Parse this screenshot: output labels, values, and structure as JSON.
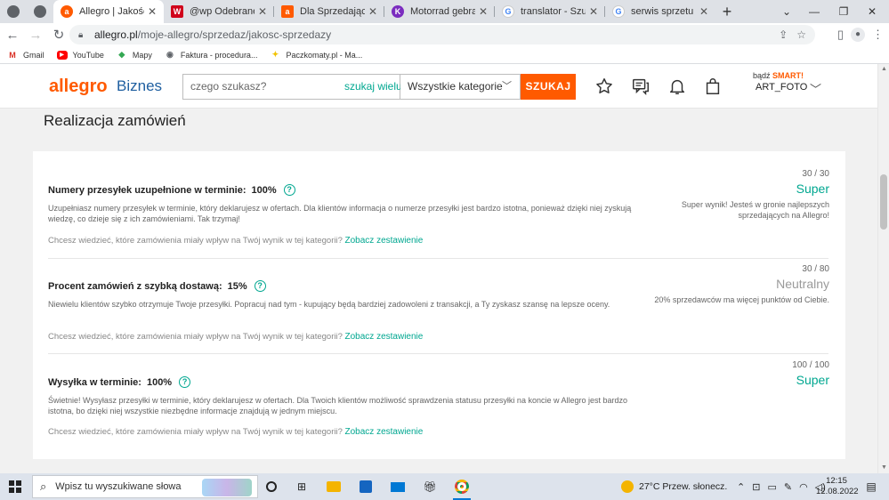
{
  "browser": {
    "tabs": [
      {
        "label": "",
        "icon": "chrome-icon",
        "small": true
      },
      {
        "label": "",
        "icon": "globe-icon",
        "small": true
      },
      {
        "label": "Allegro | Jakość moje",
        "icon": "allegro-icon",
        "active": true
      },
      {
        "label": "@wp Odebrane - W",
        "icon": "wp-icon"
      },
      {
        "label": "Dla Sprzedających -",
        "icon": "allegro-icon"
      },
      {
        "label": "Motorrad gebraucht",
        "icon": "motorrad-icon"
      },
      {
        "label": "translator - Szukaj w",
        "icon": "google-icon"
      },
      {
        "label": "serwis sprzetu fotog",
        "icon": "google-icon"
      }
    ],
    "new_tab": "+",
    "url_host": "allegro.pl",
    "url_path": "/moje-allegro/sprzedaz/jakosc-sprzedazy",
    "bookmarks": [
      {
        "label": "Gmail",
        "icon": "gmail-icon",
        "color": "#d93025"
      },
      {
        "label": "YouTube",
        "icon": "youtube-icon",
        "color": "#ff0000"
      },
      {
        "label": "Mapy",
        "icon": "maps-icon",
        "color": "#1a73e8"
      },
      {
        "label": "Faktura - procedura...",
        "icon": "globe-icon",
        "color": "#5f6368"
      },
      {
        "label": "Paczkomaty.pl - Ma...",
        "icon": "inpost-icon",
        "color": "#f2c200"
      }
    ]
  },
  "header": {
    "logo": "allegro",
    "logo_sub": "Biznes",
    "search_placeholder": "czego szukasz?",
    "search_many": "szukaj wielu",
    "category": "Wszystkie kategorie",
    "search_button": "SZUKAJ",
    "smart_prefix": "bądź",
    "smart_label": "SMART!",
    "username": "ART_FOTO"
  },
  "page": {
    "title": "Realizacja zamówień",
    "metrics": [
      {
        "title": "Numery przesyłek uzupełnione w terminie:",
        "value": "100%",
        "description": "Uzupełniasz numery przesyłek w terminie, który deklarujesz w ofertach. Dla klientów informacja o numerze przesyłki jest bardzo istotna, ponieważ dzięki niej zyskują wiedzę, co dzieje się z ich zamówieniami. Tak trzymaj!",
        "more_text": "Chcesz wiedzieć, które zamówienia miały wpływ na Twój wynik w tej kategorii?",
        "more_link": "Zobacz zestawienie",
        "score": "30 / 30",
        "rating": "Super",
        "note": "Super wynik! Jesteś w gronie najlepszych sprzedających na Allegro!"
      },
      {
        "title": "Procent zamówień z szybką dostawą:",
        "value": "15%",
        "description": "Niewielu klientów szybko otrzymuje Twoje przesyłki. Popracuj nad tym - kupujący będą bardziej zadowoleni z transakcji, a Ty zyskasz szansę na lepsze oceny.",
        "more_text": "Chcesz wiedzieć, które zamówienia miały wpływ na Twój wynik w tej kategorii?",
        "more_link": "Zobacz zestawienie",
        "score": "30 / 80",
        "rating": "Neutralny",
        "note": "20% sprzedawców ma więcej punktów od Ciebie."
      },
      {
        "title": "Wysyłka w terminie:",
        "value": "100%",
        "description": "Świetnie! Wysyłasz przesyłki w terminie, który deklarujesz w ofertach. Dla Twoich klientów możliwość sprawdzenia statusu przesyłki na koncie w Allegro jest bardzo istotna, bo dzięki niej wszystkie niezbędne informacje znajdują w jednym miejscu.",
        "more_text": "Chcesz wiedzieć, które zamówienia miały wpływ na Twój wynik w tej kategorii?",
        "more_link": "Zobacz zestawienie",
        "score": "100 / 100",
        "rating": "Super",
        "note": ""
      }
    ]
  },
  "taskbar": {
    "search_placeholder": "Wpisz tu wyszukiwane słowa",
    "weather": "27°C  Przew. słonecz.",
    "time": "12:15",
    "date": "12.08.2022"
  },
  "colors": {
    "allegro_orange": "#ff5a00",
    "teal": "#00a790",
    "biznes_blue": "#1f5fa0"
  }
}
